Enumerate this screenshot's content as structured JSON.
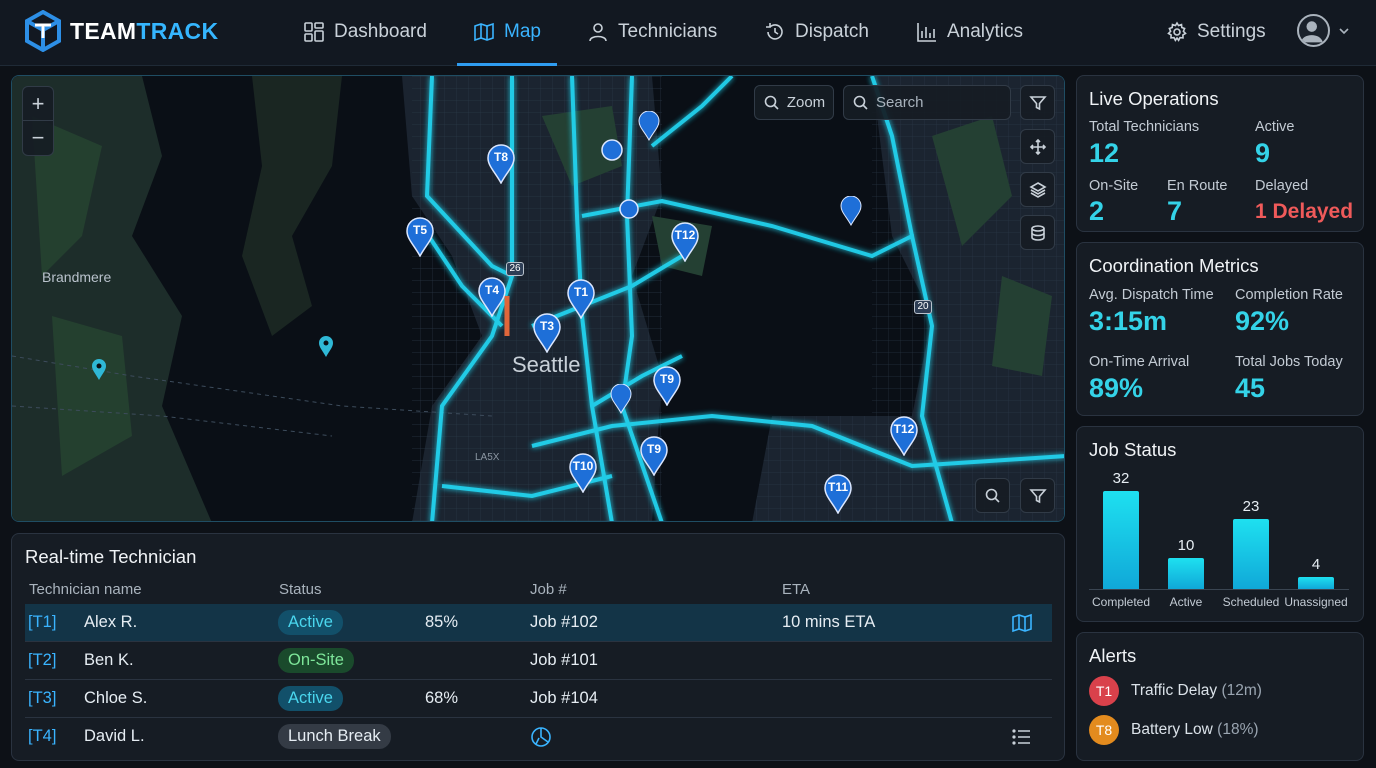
{
  "app": {
    "brand_part1": "TEAM",
    "brand_part2": "TRACK"
  },
  "nav": {
    "items": [
      {
        "label": "Dashboard",
        "icon": "grid-icon"
      },
      {
        "label": "Map",
        "icon": "map-icon",
        "active": true
      },
      {
        "label": "Technicians",
        "icon": "user-icon"
      },
      {
        "label": "Dispatch",
        "icon": "history-icon"
      },
      {
        "label": "Analytics",
        "icon": "bar-chart-icon"
      }
    ],
    "settings_label": "Settings"
  },
  "map": {
    "zoom_label": "Zoom",
    "search_placeholder": "Search",
    "city_label": "Seattle",
    "area_label": "Brandmere",
    "small_label": "LA5X",
    "shield_26": "26",
    "shield_20": "20",
    "pins": [
      "T8",
      "T5",
      "T12",
      "T4",
      "T1",
      "T3",
      "T9",
      "T9",
      "T10",
      "T11",
      "T12"
    ]
  },
  "live_operations": {
    "title": "Live Operations",
    "total_label": "Total Technicians",
    "total_value": "12",
    "active_label": "Active",
    "active_value": "9",
    "onsite_label": "On-Site",
    "onsite_value": "2",
    "enroute_label": "En Route",
    "enroute_value": "7",
    "delayed_label": "Delayed",
    "delayed_value": "1 Delayed",
    "accent_color": "#34d3e8",
    "alert_color": "#ef5a5a"
  },
  "coordination": {
    "title": "Coordination Metrics",
    "dispatch_label": "Avg. Dispatch Time",
    "dispatch_value": "3:15m",
    "completion_label": "Completion Rate",
    "completion_value": "92%",
    "ontime_label": "On-Time Arrival",
    "ontime_value": "89%",
    "jobs_label": "Total Jobs Today",
    "jobs_value": "45"
  },
  "job_status": {
    "title": "Job Status"
  },
  "chart_data": {
    "type": "bar",
    "title": "Job Status",
    "categories": [
      "Completed",
      "Active",
      "Scheduled",
      "Unassigned"
    ],
    "values": [
      32,
      10,
      23,
      4
    ],
    "ylim": [
      0,
      32
    ],
    "grid": false
  },
  "alerts": {
    "title": "Alerts",
    "items": [
      {
        "tech": "T1",
        "text": "Traffic Delay",
        "detail": "(12m)",
        "color": "#d9414b"
      },
      {
        "tech": "T8",
        "text": "Battery Low",
        "detail": "(18%)",
        "color": "#e38b1e"
      }
    ]
  },
  "technicians": {
    "title": "Real-time Technician",
    "columns": {
      "name": "Technician name",
      "status": "Status",
      "job": "Job #",
      "eta": "ETA"
    },
    "rows": [
      {
        "id": "[T1]",
        "name": "Alex R.",
        "status": "Active",
        "progress": "85%",
        "job": "Job #102",
        "eta": "10 mins ETA"
      },
      {
        "id": "[T2]",
        "name": "Ben K.",
        "status": "On-Site",
        "progress": "",
        "job": "Job #101",
        "eta": ""
      },
      {
        "id": "[T3]",
        "name": "Chloe S.",
        "status": "Active",
        "progress": "68%",
        "job": "Job #104",
        "eta": ""
      },
      {
        "id": "[T4]",
        "name": "David L.",
        "status": "Lunch Break",
        "progress": "",
        "job": "",
        "eta": ""
      }
    ]
  }
}
